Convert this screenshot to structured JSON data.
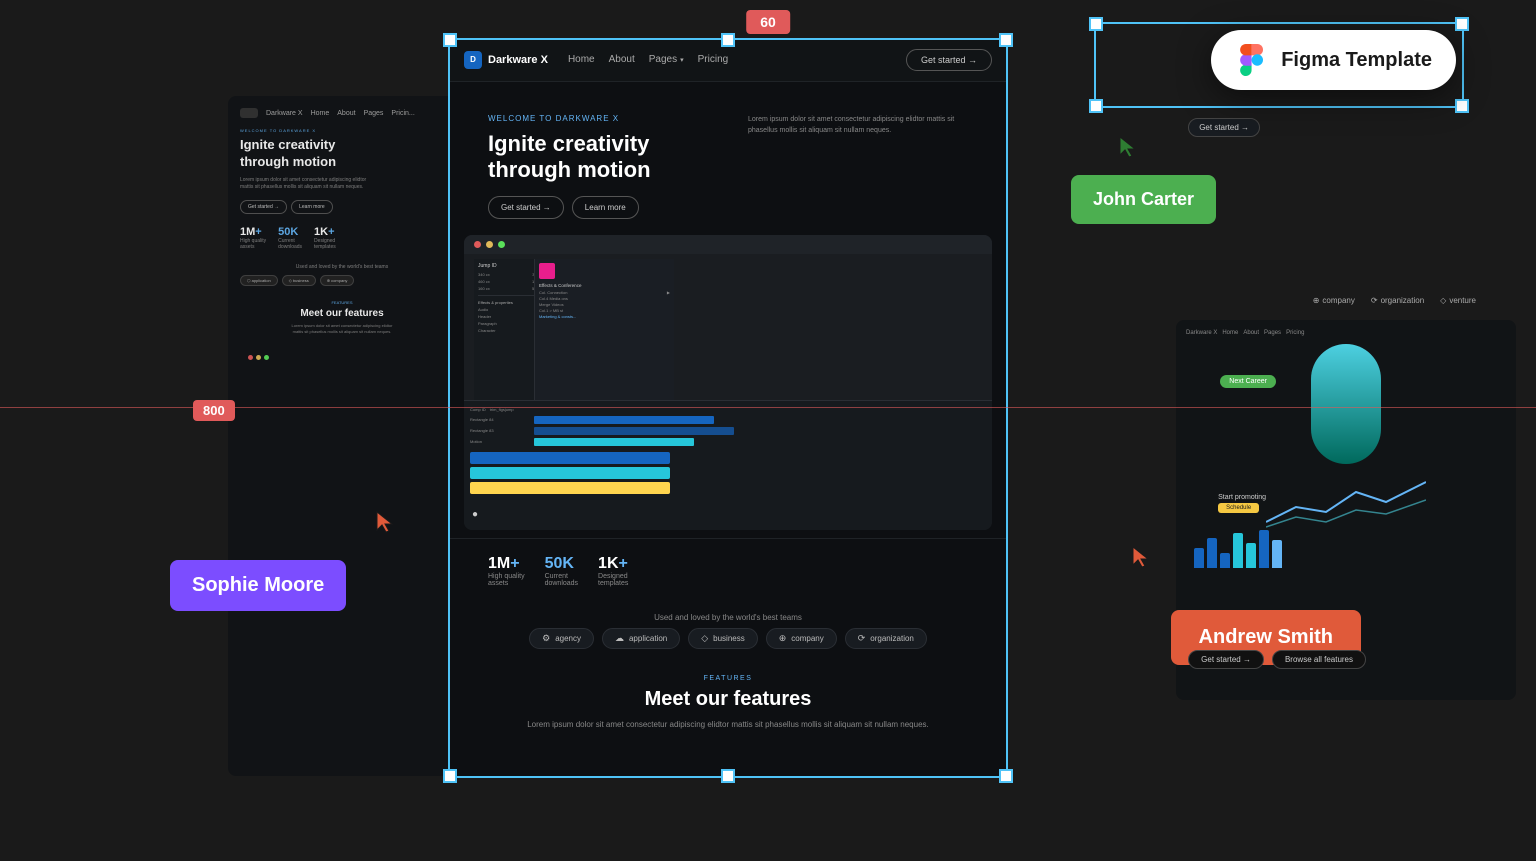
{
  "canvas": {
    "bg_color": "#1a1a1a"
  },
  "badges": {
    "sixty": "60",
    "eight_hundred": "800"
  },
  "figma_template": {
    "label": "Figma Template"
  },
  "user_badges": {
    "john_carter": "John Carter",
    "sophie_moore": "Sophie Moore",
    "andrew_smith": "Andrew Smith"
  },
  "main_card": {
    "nav": {
      "logo": "Darkware X",
      "links": [
        "Home",
        "About",
        "Pages",
        "Pricing"
      ],
      "cta": "Get started →"
    },
    "hero": {
      "welcome_tag": "WELCOME TO DARKWARE X",
      "title_line1": "Ignite creativity",
      "title_line2": "through motion",
      "description": "Lorem ipsum dolor sit amet consectetur adipiscing elidtor mattis sit phasellus mollis sit aliquam sit nullam neques.",
      "btn_primary": "Get started →",
      "btn_secondary": "Learn more"
    },
    "stats": [
      {
        "value": "1M+",
        "accent": "",
        "label": "High quality\nassets"
      },
      {
        "value": "50K",
        "accent": "",
        "label": "Current\ndownloads"
      },
      {
        "value": "1K+",
        "accent": "",
        "label": "Designed\ntemplates"
      }
    ],
    "used_loved": {
      "heading": "Used and loved by the world's best teams",
      "pills": [
        "agency",
        "application",
        "business",
        "company",
        "organization"
      ]
    },
    "features": {
      "tag": "FEATURES",
      "title": "Meet our features",
      "description": "Lorem ipsum dolor sit amet consectetur adipiscing elidtor\nmattis sit phasellus mollis sit aliquam sit nullam neques."
    }
  },
  "org_labels": [
    "company",
    "organization",
    "venture"
  ],
  "bottom_btns": {
    "get_started": "Get started →",
    "browse": "Browse all features"
  },
  "next_career": "Next Career",
  "start_promoting": "Start promoting",
  "schedule": "Schedule"
}
